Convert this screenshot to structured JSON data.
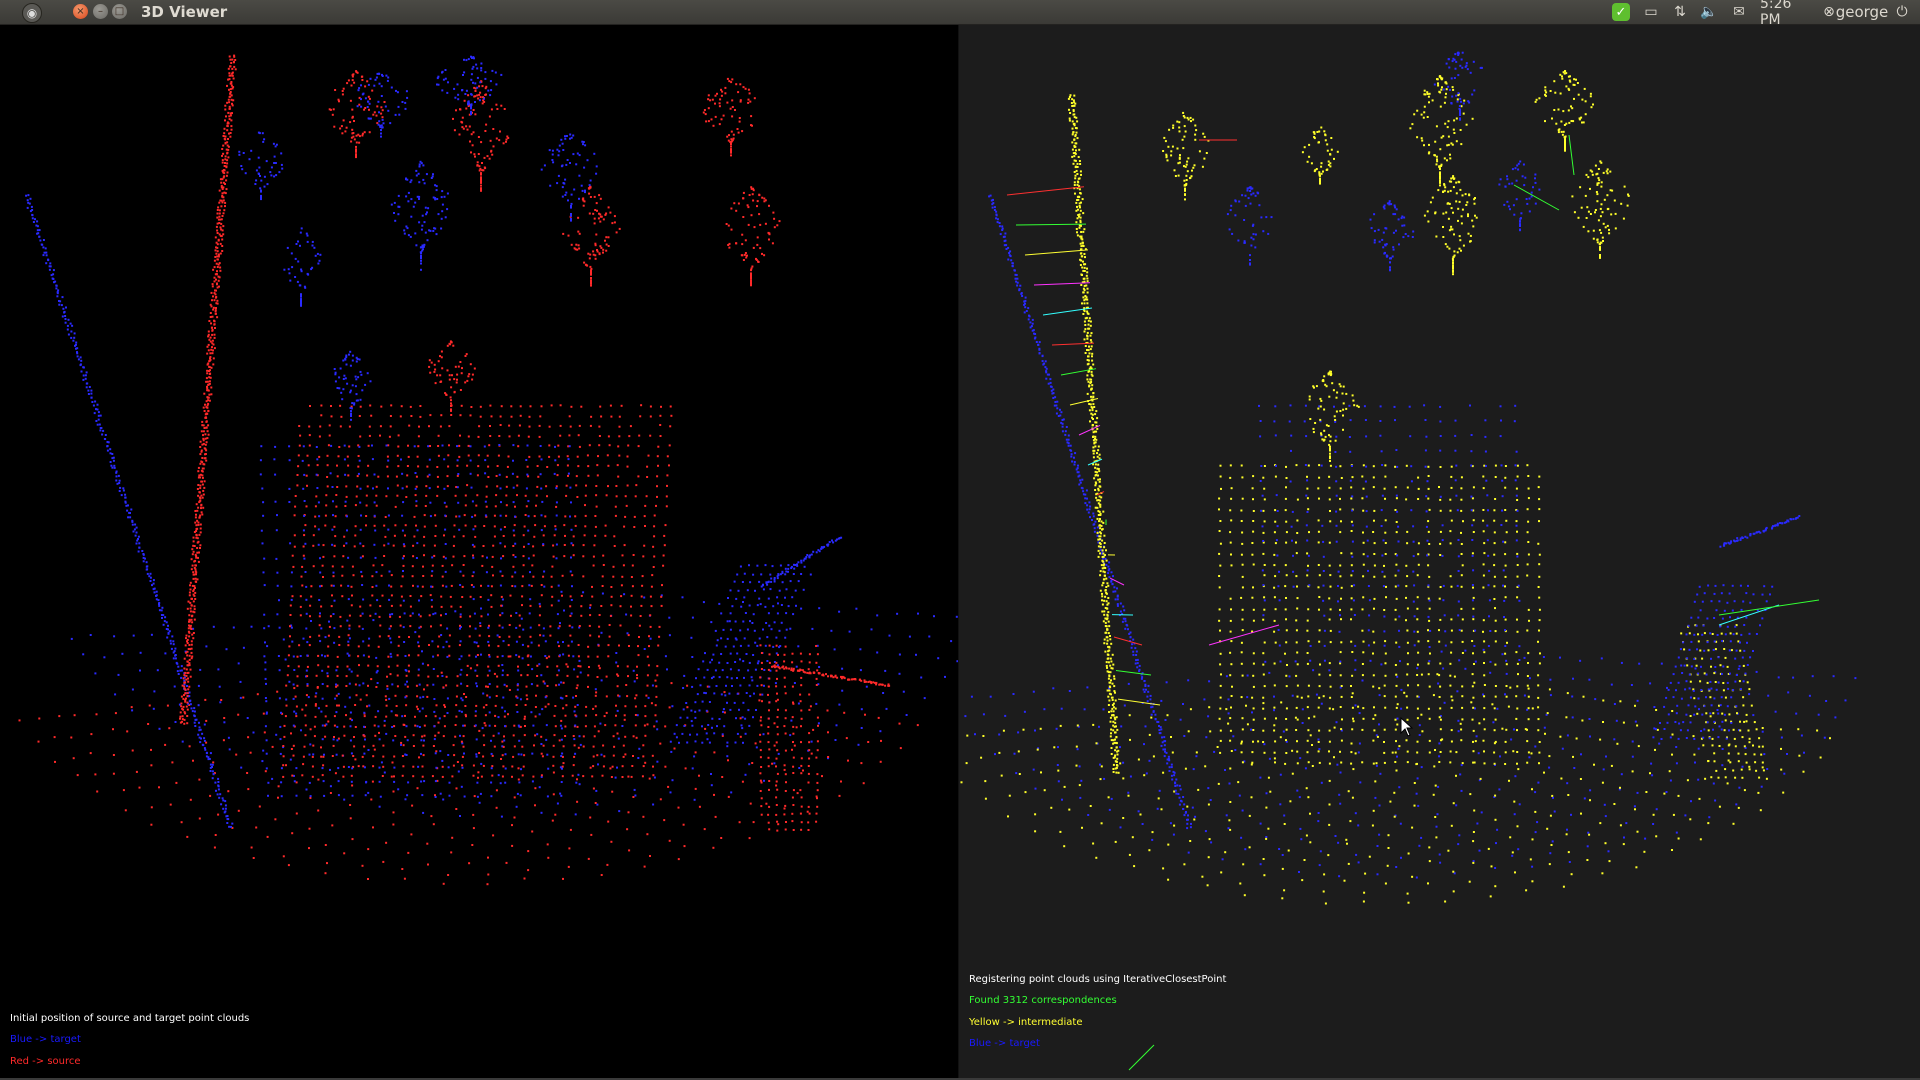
{
  "topbar": {
    "window_title": "3D Viewer",
    "clock": "5:26 PM",
    "username": "george",
    "icons": [
      "ubuntu-logo-icon",
      "close-icon",
      "minimize-icon",
      "maximize-icon",
      "update-check-icon",
      "monitor-icon",
      "network-transfer-icon",
      "volume-muted-icon",
      "mail-icon",
      "user-icon",
      "power-icon"
    ]
  },
  "left_view": {
    "background": "#000000",
    "text_lines": [
      {
        "text": "Initial position of source and target point clouds",
        "color": "#ffffff"
      },
      {
        "text": "Blue -> target",
        "color": "#1a1aff"
      },
      {
        "text": "Red  -> source",
        "color": "#ff2a2a"
      }
    ]
  },
  "right_view": {
    "background": "#1c1c1c",
    "text_lines": [
      {
        "text": "Registering point clouds using IterativeClosestPoint",
        "color": "#ffffff"
      },
      {
        "text": "Found 3312 correspondences",
        "color": "#33ff33"
      },
      {
        "text": "Yellow -> intermediate",
        "color": "#ffff33"
      },
      {
        "text": "Blue -> target",
        "color": "#1a1aff"
      }
    ]
  },
  "colors": {
    "target": "#2a2aff",
    "source": "#ff2a2a",
    "intermediate": "#ffff2a"
  }
}
